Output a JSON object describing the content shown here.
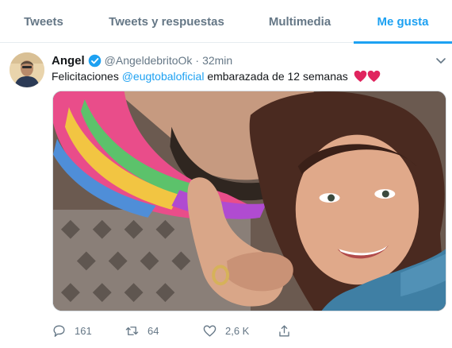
{
  "tabs": [
    {
      "label": "Tweets"
    },
    {
      "label": "Tweets y respuestas"
    },
    {
      "label": "Multimedia"
    },
    {
      "label": "Me gusta"
    }
  ],
  "active_tab": "Me gusta",
  "tweet": {
    "author_name": "Angel",
    "verified": true,
    "handle": "@AngeldebritoOk",
    "separator": "·",
    "time": "32min",
    "text_before": "Felicitaciones ",
    "mention": "@eugtobaloficial",
    "text_after": " embarazada de 12 semanas",
    "emoji": [
      "red-heart",
      "red-heart"
    ],
    "media": "photo",
    "counts": {
      "replies": "161",
      "retweets": "64",
      "likes": "2,6 K"
    }
  },
  "colors": {
    "accent": "#1da1f2",
    "secondary_text": "#657786",
    "primary_text": "#14171a",
    "heart": "#e0245e",
    "border": "#e6ecf0"
  },
  "icons": {
    "verified": "verified-badge-icon",
    "caret": "chevron-down-icon",
    "reply": "reply-icon",
    "retweet": "retweet-icon",
    "like": "heart-icon",
    "share": "share-icon"
  }
}
